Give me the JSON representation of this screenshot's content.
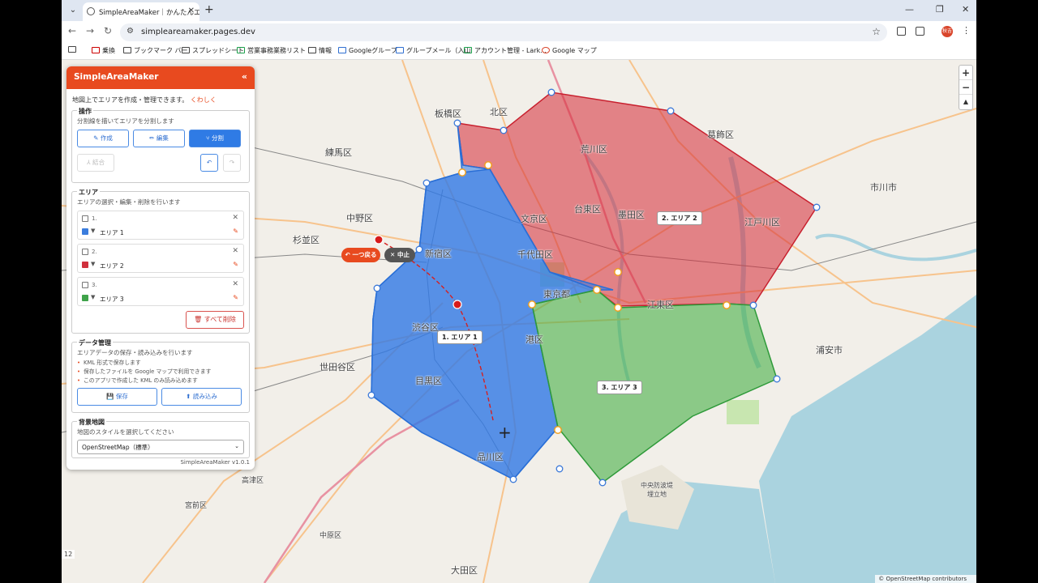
{
  "browser": {
    "tab_title": "SimpleAreaMaker｜かんたんエリ",
    "url": "simpleareamaker.pages.dev",
    "profile_initials": "秋吉",
    "bookmarks": [
      "乗換",
      "ブックマーク バー",
      "スプレッドシート",
      "営業事務業務リスト",
      "情報",
      "Googleグループ",
      "グループメール（入山",
      "アカウント管理 - Lark...",
      "Google マップ"
    ]
  },
  "panel": {
    "title": "SimpleAreaMaker",
    "collapse": "«",
    "intro": "地図上でエリアを作成・管理できます。",
    "intro_link": "くわしく",
    "ops": {
      "title": "操作",
      "desc": "分割線を描いてエリアを分割します",
      "create": "作成",
      "edit": "編集",
      "split": "分割",
      "merge": "結合",
      "undo_icon": "↶",
      "redo_icon": "↷"
    },
    "areas": {
      "title": "エリア",
      "desc": "エリアの選択・編集・削除を行います",
      "items": [
        {
          "num": "1.",
          "name": "エリア 1",
          "color": "#3b7ddd"
        },
        {
          "num": "2.",
          "name": "エリア 2",
          "color": "#d0303d"
        },
        {
          "num": "3.",
          "name": "エリア 3",
          "color": "#3fa34a"
        }
      ],
      "delete_all": "すべて削除"
    },
    "data": {
      "title": "データ管理",
      "desc": "エリアデータの保存・読み込みを行います",
      "notes": [
        "KML 形式で保存します",
        "保存したファイルを Google マップで利用できます",
        "このアプリで作成した KML のみ読み込めます"
      ],
      "save": "保存",
      "load": "読み込み"
    },
    "basemap": {
      "title": "背景地図",
      "desc": "地図のスタイルを選択してください",
      "selected": "OpenStreetMap（標準）"
    },
    "version": "SimpleAreaMaker v1.0.1"
  },
  "map": {
    "undo_point": "一つ戻る",
    "stop": "中止",
    "area_labels": [
      "1. エリア 1",
      "2. エリア 2",
      "3. エリア 3"
    ],
    "place_labels": [
      "板橋区",
      "北区",
      "葛飾区",
      "練馬区",
      "荒川区",
      "市川市",
      "中野区",
      "文京区",
      "台東区",
      "墨田区",
      "江戸川区",
      "杉並区",
      "新宿区",
      "千代田区",
      "東京都",
      "江東区",
      "渋谷区",
      "港区",
      "浦安市",
      "世田谷区",
      "目黒区",
      "品川区",
      "中央防波堤埋立地",
      "高津区",
      "宮前区",
      "大田区",
      "中原区"
    ],
    "attribution": "© OpenStreetMap contributors",
    "scale_text": "12",
    "zoom_in": "+",
    "zoom_out": "−",
    "reset": "▲"
  }
}
